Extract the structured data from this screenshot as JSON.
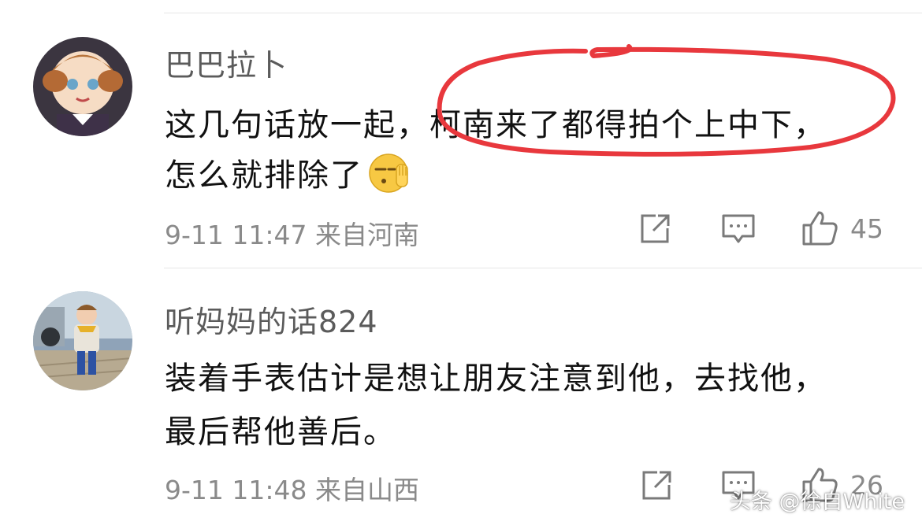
{
  "comments": [
    {
      "username": "巴巴拉卜",
      "text_line1_a": "这几句话放一起，",
      "text_line1_b": "柯南来了都得拍个上中下，",
      "text_line2": "怎么就排除了",
      "emoji": "smirk-wave-emoji",
      "meta": "9-11 11:47 来自河南",
      "likes": "45"
    },
    {
      "username": "听妈妈的话824",
      "text_line1": "装着手表估计是想让朋友注意到他，去找他，",
      "text_line2": "最后帮他善后。",
      "meta": "9-11 11:48 来自山西",
      "likes": "26"
    }
  ],
  "icons": {
    "share": "share-icon",
    "reply": "comment-icon",
    "like": "thumbs-up-icon"
  },
  "colors": {
    "highlight_circle": "#e8383d",
    "username": "#5b5b5b",
    "meta": "#8a8a8a"
  },
  "watermark": "头条 @徐自White"
}
